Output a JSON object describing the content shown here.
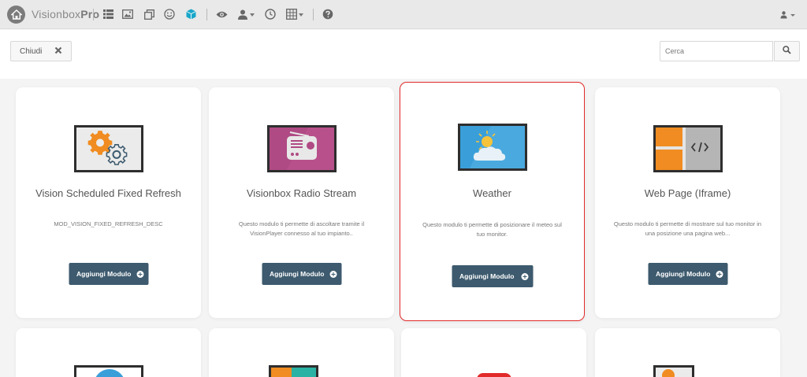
{
  "app": {
    "brand_light": "Visionbox",
    "brand_bold": "Pro"
  },
  "nav_icons": [
    "home-icon",
    "list-icon",
    "image-icon",
    "copy-icon",
    "smile-icon",
    "cube-icon",
    "eye-icon",
    "user-dropdown-icon",
    "clock-icon",
    "grid-dropdown-icon",
    "help-icon"
  ],
  "toolbar": {
    "close_label": "Chiudi",
    "search_placeholder": "Cerca"
  },
  "colors": {
    "accent": "#3d5a6e",
    "selected_border": "#e22a2a",
    "cube_active": "#1aa6c9"
  },
  "modules": [
    {
      "title": "Vision Scheduled Fixed Refresh",
      "description": "MOD_VISION_FIXED_REFRESH_DESC",
      "button": "Aggiungi Modulo",
      "icon": "gears-icon"
    },
    {
      "title": "Visionbox Radio Stream",
      "description": "Questo modulo ti permette di ascoltare tramite il VisionPlayer connesso al tuo impianto..",
      "button": "Aggiungi Modulo",
      "icon": "radio-icon"
    },
    {
      "title": "Weather",
      "description": "Questo modulo ti permette di posizionare il meteo sul tuo monitor.",
      "button": "Aggiungi Modulo",
      "icon": "weather-icon",
      "selected": true
    },
    {
      "title": "Web Page (Iframe)",
      "description": "Questo modulo ti permette di mostrare sul tuo monitor in una posizione una pagina web...",
      "button": "Aggiungi Modulo",
      "icon": "webpage-icon"
    }
  ]
}
